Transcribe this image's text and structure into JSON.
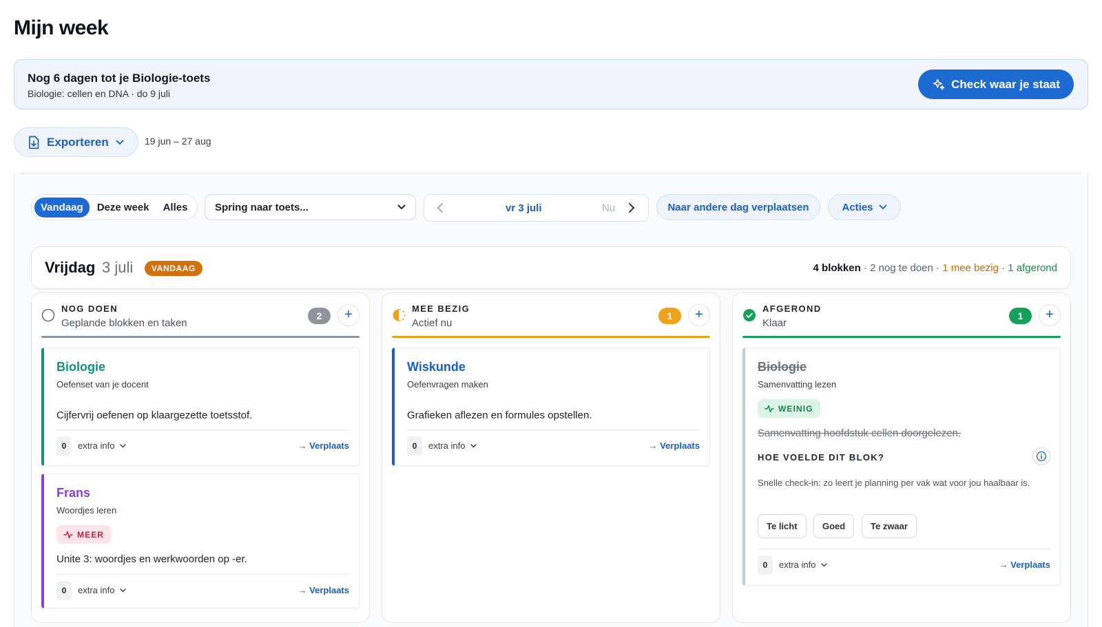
{
  "page": {
    "title": "Mijn week"
  },
  "banner": {
    "title": "Nog 6 dagen tot je Biologie-toets",
    "subtitle": "Biologie: cellen en DNA · do 9 juli",
    "button_label": "Check waar je staat"
  },
  "toolbar": {
    "export_label": "Exporteren",
    "date_range": "19 jun – 27 aug"
  },
  "filters": {
    "segments": [
      "Vandaag",
      "Deze week",
      "Alles"
    ],
    "active_segment": "Vandaag",
    "jump_select": "Spring naar toets...",
    "current_day": "vr 3 juli",
    "now_label": "Nu",
    "move_label": "Naar andere dag verplaatsen",
    "actions_label": "Acties"
  },
  "day": {
    "name": "Vrijdag",
    "date": "3 juli",
    "badge": "VANDAAG",
    "summary": {
      "blocks": "4 blokken",
      "todo": "2 nog te doen",
      "busy": "1 mee bezig",
      "done": "1 afgerond",
      "sep": " · "
    }
  },
  "columns": [
    {
      "title": "NOG DOEN",
      "subtitle": "Geplande blokken en taken",
      "count": "2",
      "add": "+",
      "color": "#8e959c",
      "cards": [
        {
          "subject": "Biologie",
          "subtitle": "Oefenset van je docent",
          "description": "Cijfervrij oefenen op klaargezette toetsstof.",
          "extra_count": "0",
          "extra_label": "extra info",
          "move_label": "→ Verplaats",
          "accent": "#15907e"
        },
        {
          "subject": "Frans",
          "subtitle": "Woordjes leren",
          "tag": "MEER",
          "description": "Unite 3: woordjes en werkwoorden op -er.",
          "extra_count": "0",
          "extra_label": "extra info",
          "move_label": "→ Verplaats",
          "accent": "#8b3fd8"
        }
      ]
    },
    {
      "title": "MEE BEZIG",
      "subtitle": "Actief nu",
      "count": "1",
      "add": "+",
      "color": "#f0a21c",
      "cards": [
        {
          "subject": "Wiskunde",
          "subtitle": "Oefenvragen maken",
          "description": "Grafieken aflezen en formules opstellen.",
          "extra_count": "0",
          "extra_label": "extra info",
          "move_label": "→ Verplaats",
          "accent": "#1c5fc4"
        }
      ]
    },
    {
      "title": "AFGEROND",
      "subtitle": "Klaar",
      "count": "1",
      "add": "+",
      "color": "#16a05a",
      "cards": [
        {
          "subject": "Biologie",
          "subtitle": "Samenvatting lezen",
          "tag": "WEINIG",
          "description": "Samenvatting hoofdstuk cellen doorgelezen.",
          "feel_question": "HOE VOELDE DIT BLOK?",
          "feel_text": "Snelle check-in: zo leert je planning per vak wat voor jou haalbaar is.",
          "feel_options": [
            "Te licht",
            "Goed",
            "Te zwaar"
          ],
          "extra_count": "0",
          "extra_label": "extra info",
          "move_label": "→ Verplaats",
          "accent": "#c5cbd2"
        }
      ]
    }
  ]
}
